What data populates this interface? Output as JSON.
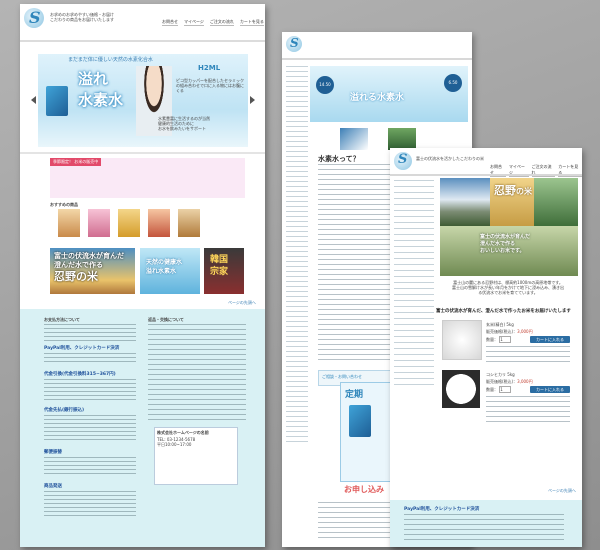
{
  "page1": {
    "logo_text": "S",
    "tagline_1": "お求めのお求めやすい価格・お届け",
    "tagline_2": "こだわりの商品をお届けいたします",
    "nav": [
      "お問合せ",
      "マイページ",
      "ご注文の流れ",
      "カートを見る"
    ],
    "banner": {
      "headline": "まだまだ体に優しい天然の水素化合水",
      "title_a": "溢れ",
      "title_b": "水素水",
      "badge": "H2ML",
      "side_text": "ピコ型カッパーを配合したセラミックの組み合わせで口に入る物にはお腹にくる",
      "bullets": [
        "水素豊富に生活するのが当然",
        "健康的生活のために",
        "お水を飲みたいをサポート"
      ]
    },
    "season_label": "季節限定！ お米の販売中",
    "recommend_label": "おすすめの商品",
    "cards": [
      {
        "line1": "富士の伏流水が育んだ",
        "line2": "澄んだ水で作る",
        "line3": "忍野の米"
      },
      {
        "line1": "天然の健康水",
        "line2": "溢れ水素水"
      },
      {
        "line1": "韓国",
        "line2": "宗家"
      }
    ],
    "pagetop": "ページの先頭へ",
    "footer": {
      "payment_title": "お支払方法について",
      "paypal": "PayPal利用、クレジットカード決済",
      "delivery_title": "代金引換(代金引換料315~367円)",
      "bank_title": "代金先払(銀行振込)",
      "postal_title": "郵便振替",
      "shipping_title": "商品発送",
      "return_title": "返品・交換について",
      "company": "株式会社ホームページの名前",
      "phone": "TEL: 03-1234-5678",
      "hours": "平日10:00~17:00"
    }
  },
  "page2": {
    "banner_badge_left": "14.50",
    "banner_badge_right": "6.50",
    "banner_text": "溢れる水素水",
    "section_title": "水素水って？",
    "consult": "ご相談・お問い合わせ",
    "card_title": "定期",
    "apply": "お申し込み"
  },
  "page3": {
    "tagline": "富士の伏流水を活かしたこだわりの米",
    "nav": [
      "お問合せ",
      "マイページ",
      "ご注文の流れ",
      "カートを見る"
    ],
    "brand_main": "忍野",
    "brand_sub": "の米",
    "hero_line1": "富士の伏流水が育んだ",
    "hero_line2": "澄んだ水で作る",
    "hero_line3": "おいしいお米です。",
    "intro": "富士山の麓にある忍野村は、標高約1000mの高原地帯です。富士山の雪解け水が長い年月をかけて地下に浸み込み、湧き出る伏流水でお米を育てています。",
    "slogan": "富士の伏流水が育んだ、澄んだ水で作ったお米をお届けいたします",
    "products": [
      {
        "name": "玄米(精白) 5kg",
        "price_label": "販売価格(税込)：",
        "price": "3,000円",
        "qty_label": "数量：",
        "qty": "1",
        "cart": "カートに入れる"
      },
      {
        "name": "コシヒカリ 5kg",
        "price_label": "販売価格(税込)：",
        "price": "3,000円",
        "qty_label": "数量：",
        "qty": "1",
        "cart": "カートに入れる"
      }
    ],
    "pagetop": "ページの先頭へ",
    "paypal": "PayPal利用、クレジットカード決済"
  },
  "colors": {
    "brand_blue": "#2f86bb",
    "footer_bg": "#d9f1f4",
    "season_pink": "#fae9f6",
    "cart_blue": "#2b6da3"
  }
}
